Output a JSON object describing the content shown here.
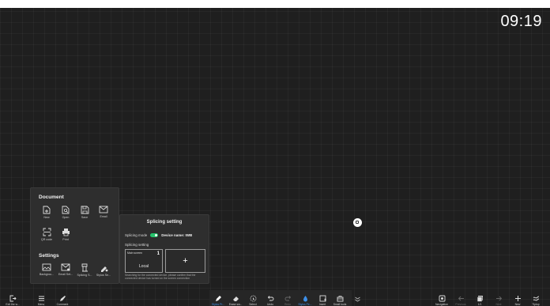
{
  "clock": "09:19",
  "document_panel": {
    "title": "Document",
    "items": [
      {
        "label": "New",
        "icon": "new-file-icon"
      },
      {
        "label": "Open",
        "icon": "open-file-icon"
      },
      {
        "label": "Save",
        "icon": "save-icon"
      },
      {
        "label": "Email",
        "icon": "email-icon"
      },
      {
        "label": "QR code",
        "icon": "qr-code-icon"
      },
      {
        "label": "Print",
        "icon": "print-icon"
      }
    ],
    "settings_title": "Settings",
    "settings_items": [
      {
        "label": "Backgrou...",
        "icon": "background-icon"
      },
      {
        "label": "Email Set...",
        "icon": "email-settings-icon"
      },
      {
        "label": "Splicing S...",
        "icon": "splicing-settings-icon"
      },
      {
        "label": "Stylus Se...",
        "icon": "stylus-settings-icon"
      }
    ]
  },
  "splicing_panel": {
    "title": "Splicing setting",
    "mode_label": "Splicing mode",
    "mode_on": true,
    "device_name_label": "Device name: IWB",
    "setting_label": "Splicing setting",
    "screen_name": "Main screen",
    "screen_number": "1",
    "screen_local": "Local",
    "add_label": "+",
    "hint": "Searching for the connected device, please confirm that the connected device has turned on the screen connection"
  },
  "bottom_left": [
    {
      "label": "Exit the w...",
      "icon": "exit-icon"
    },
    {
      "label": "Menu",
      "icon": "menu-icon"
    },
    {
      "label": "Comment",
      "icon": "comment-pen-icon"
    }
  ],
  "bottom_center": [
    {
      "label": "Stylus Pr...",
      "icon": "stylus-icon",
      "active": true
    },
    {
      "label": "Erase sw...",
      "icon": "eraser-icon",
      "active": false
    },
    {
      "label": "Select",
      "icon": "select-icon",
      "active": false
    },
    {
      "label": "Undo",
      "icon": "undo-icon",
      "active": false
    },
    {
      "label": "Redo",
      "icon": "redo-icon",
      "active": false,
      "disabled": true
    },
    {
      "label": "Stylus Pe...",
      "icon": "stylus-pen-icon",
      "active": true
    },
    {
      "label": "Insert",
      "icon": "insert-icon",
      "active": false
    },
    {
      "label": "Small tools",
      "icon": "small-tools-icon",
      "active": false
    }
  ],
  "bottom_right": [
    {
      "label": "Navigation",
      "icon": "navigation-icon"
    },
    {
      "label": "Previous",
      "icon": "previous-icon",
      "disabled": true
    },
    {
      "label": "1/1",
      "icon": "pages-icon"
    },
    {
      "label": "Next",
      "icon": "next-icon",
      "disabled": true
    },
    {
      "label": "New",
      "icon": "new-page-icon"
    },
    {
      "label": "Tiptop",
      "icon": "tiptop-icon"
    }
  ],
  "colors": {
    "accent": "#3d8fe8",
    "toggle_on": "#25c26b",
    "background": "#1f1f1f"
  }
}
